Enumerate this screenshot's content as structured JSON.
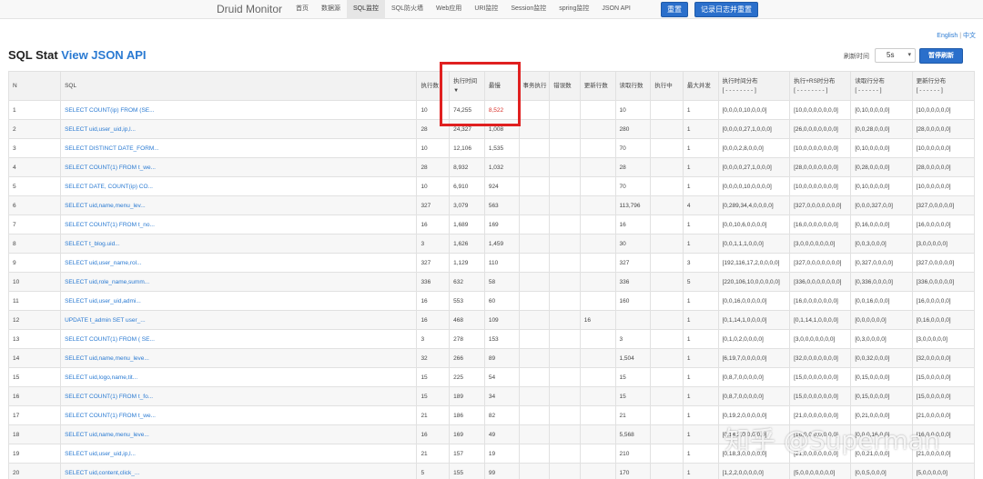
{
  "navbar": {
    "brand": "Druid Monitor",
    "items": [
      "首页",
      "数据源",
      "SQL监控",
      "SQL防火墙",
      "Web应用",
      "URI监控",
      "Session监控",
      "spring监控",
      "JSON API"
    ],
    "active_index": 2,
    "reset_button": "重置",
    "log_reset_button": "记录日志并重置"
  },
  "lang": {
    "english": "English",
    "separator": "|",
    "chinese": "中文"
  },
  "header": {
    "title": "SQL Stat",
    "json_link": "View JSON API",
    "refresh_label": "刷新时间",
    "refresh_value": "5s",
    "pause_button": "暂停刷新"
  },
  "table": {
    "columns": [
      "N",
      "SQL",
      "执行数",
      "执行时间",
      "最慢",
      "事务执行",
      "错误数",
      "更新行数",
      "读取行数",
      "执行中",
      "最大并发",
      "执行时间分布",
      "执行+RS时分布",
      "读取行分布",
      "更新行分布"
    ],
    "sort_icon": "▼",
    "dist_placeholder": "[ - - - - - - - - ]",
    "dist_placeholder_short": "[ - - - - - - ]",
    "rows": [
      [
        "1",
        "SELECT COUNT(ip) FROM (SE...",
        "10",
        "74,255",
        "8,522",
        "",
        "",
        "",
        "10",
        "",
        "1",
        "[0,0,0,0,10,0,0,0]",
        "[10,0,0,0,0,0,0,0]",
        "[0,10,0,0,0,0]",
        "[10,0,0,0,0,0]"
      ],
      [
        "2",
        "SELECT uid,user_uid,ip,l...",
        "28",
        "24,327",
        "1,008",
        "",
        "",
        "",
        "280",
        "",
        "1",
        "[0,0,0,0,27,1,0,0,0]",
        "[26,0,0,0,0,0,0,0]",
        "[0,0,28,0,0,0]",
        "[28,0,0,0,0,0]"
      ],
      [
        "3",
        "SELECT DISTINCT DATE_FORM...",
        "10",
        "12,106",
        "1,535",
        "",
        "",
        "",
        "70",
        "",
        "1",
        "[0,0,0,2,8,0,0,0]",
        "[10,0,0,0,0,0,0,0]",
        "[0,10,0,0,0,0]",
        "[10,0,0,0,0,0]"
      ],
      [
        "4",
        "SELECT COUNT(1) FROM t_we...",
        "28",
        "8,932",
        "1,032",
        "",
        "",
        "",
        "28",
        "",
        "1",
        "[0,0,0,0,27,1,0,0,0]",
        "[28,0,0,0,0,0,0,0]",
        "[0,28,0,0,0,0]",
        "[28,0,0,0,0,0]"
      ],
      [
        "5",
        "SELECT DATE, COUNT(ip) CO...",
        "10",
        "6,910",
        "924",
        "",
        "",
        "",
        "70",
        "",
        "1",
        "[0,0,0,0,10,0,0,0,0]",
        "[10,0,0,0,0,0,0,0]",
        "[0,10,0,0,0,0]",
        "[10,0,0,0,0,0]"
      ],
      [
        "6",
        "SELECT uid,name,menu_lev...",
        "327",
        "3,079",
        "563",
        "",
        "",
        "",
        "113,796",
        "",
        "4",
        "[0,289,34,4,0,0,0,0]",
        "[327,0,0,0,0,0,0,0]",
        "[0,0,0,327,0,0]",
        "[327,0,0,0,0,0]"
      ],
      [
        "7",
        "SELECT COUNT(1) FROM t_no...",
        "16",
        "1,689",
        "169",
        "",
        "",
        "",
        "16",
        "",
        "1",
        "[0,0,10,6,0,0,0,0]",
        "[16,0,0,0,0,0,0,0]",
        "[0,16,0,0,0,0]",
        "[16,0,0,0,0,0]"
      ],
      [
        "8",
        "SELECT t_blog.uid...",
        "3",
        "1,626",
        "1,459",
        "",
        "",
        "",
        "30",
        "",
        "1",
        "[0,0,1,1,1,0,0,0]",
        "[3,0,0,0,0,0,0,0]",
        "[0,0,3,0,0,0]",
        "[3,0,0,0,0,0]"
      ],
      [
        "9",
        "SELECT uid,user_name,rol...",
        "327",
        "1,129",
        "110",
        "",
        "",
        "",
        "327",
        "",
        "3",
        "[192,116,17,2,0,0,0,0]",
        "[327,0,0,0,0,0,0,0]",
        "[0,327,0,0,0,0]",
        "[327,0,0,0,0,0]"
      ],
      [
        "10",
        "SELECT uid,role_name,summ...",
        "336",
        "632",
        "58",
        "",
        "",
        "",
        "336",
        "",
        "5",
        "[220,106,10,0,0,0,0,0]",
        "[336,0,0,0,0,0,0,0]",
        "[0,336,0,0,0,0]",
        "[336,0,0,0,0,0]"
      ],
      [
        "11",
        "SELECT uid,user_uid,admi...",
        "16",
        "553",
        "60",
        "",
        "",
        "",
        "160",
        "",
        "1",
        "[0,0,16,0,0,0,0,0]",
        "[16,0,0,0,0,0,0,0]",
        "[0,0,16,0,0,0]",
        "[16,0,0,0,0,0]"
      ],
      [
        "12",
        "UPDATE t_admin SET user_...",
        "16",
        "468",
        "109",
        "",
        "",
        "16",
        "",
        "",
        "1",
        "[0,1,14,1,0,0,0,0]",
        "[0,1,14,1,0,0,0,0]",
        "[0,0,0,0,0,0]",
        "[0,16,0,0,0,0]"
      ],
      [
        "13",
        "SELECT COUNT(1) FROM ( SE...",
        "3",
        "278",
        "153",
        "",
        "",
        "",
        "3",
        "",
        "1",
        "[0,1,0,2,0,0,0,0]",
        "[3,0,0,0,0,0,0,0]",
        "[0,3,0,0,0,0]",
        "[3,0,0,0,0,0]"
      ],
      [
        "14",
        "SELECT uid,name,menu_leve...",
        "32",
        "266",
        "89",
        "",
        "",
        "",
        "1,504",
        "",
        "1",
        "[6,19,7,0,0,0,0,0]",
        "[32,0,0,0,0,0,0,0]",
        "[0,0,32,0,0,0]",
        "[32,0,0,0,0,0]"
      ],
      [
        "15",
        "SELECT uid,logo,name,tit...",
        "15",
        "225",
        "54",
        "",
        "",
        "",
        "15",
        "",
        "1",
        "[0,8,7,0,0,0,0,0]",
        "[15,0,0,0,0,0,0,0]",
        "[0,15,0,0,0,0]",
        "[15,0,0,0,0,0]"
      ],
      [
        "16",
        "SELECT COUNT(1) FROM t_fo...",
        "15",
        "189",
        "34",
        "",
        "",
        "",
        "15",
        "",
        "1",
        "[0,8,7,0,0,0,0,0]",
        "[15,0,0,0,0,0,0,0]",
        "[0,15,0,0,0,0]",
        "[15,0,0,0,0,0]"
      ],
      [
        "17",
        "SELECT COUNT(1) FROM t_we...",
        "21",
        "186",
        "82",
        "",
        "",
        "",
        "21",
        "",
        "1",
        "[0,19,2,0,0,0,0,0]",
        "[21,0,0,0,0,0,0,0]",
        "[0,21,0,0,0,0]",
        "[21,0,0,0,0,0]"
      ],
      [
        "18",
        "SELECT uid,name,menu_leve...",
        "16",
        "169",
        "49",
        "",
        "",
        "",
        "5,568",
        "",
        "1",
        "[0,14,2,0,0,0,0,0]",
        "[16,0,0,0,0,0,0,0]",
        "[0,0,0,16,0,0]",
        "[16,0,0,0,0,0]"
      ],
      [
        "19",
        "SELECT uid,user_uid,ip,l...",
        "21",
        "157",
        "19",
        "",
        "",
        "",
        "210",
        "",
        "1",
        "[0,18,3,0,0,0,0,0]",
        "[21,0,0,0,0,0,0,0]",
        "[0,0,21,0,0,0]",
        "[21,0,0,0,0,0]"
      ],
      [
        "20",
        "SELECT uid,content,click_...",
        "5",
        "155",
        "99",
        "",
        "",
        "",
        "170",
        "",
        "1",
        "[1,2,2,0,0,0,0,0]",
        "[5,0,0,0,0,0,0,0]",
        "[0,0,5,0,0,0]",
        "[5,0,0,0,0,0]"
      ]
    ],
    "highlight_color": "#e02020"
  },
  "watermark": "知乎 @Superman"
}
